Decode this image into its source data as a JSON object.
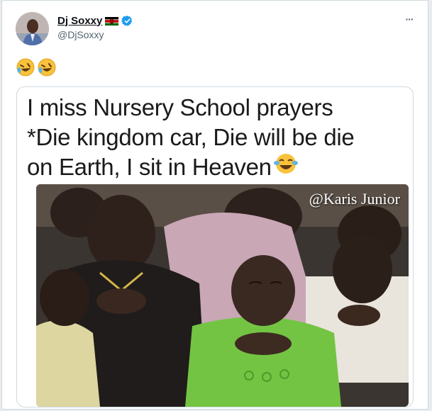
{
  "author": {
    "display_name": "Dj Soxxy",
    "handle": "@DjSoxxy",
    "flag_icon": "kenya-flag-icon",
    "verified_icon": "verified-badge-icon",
    "verified_color": "#1d9bf0"
  },
  "menu": {
    "more_icon": "more-horizontal-icon",
    "glyph": "···"
  },
  "tweet": {
    "emoji": [
      "🤣",
      "🤣"
    ]
  },
  "media": {
    "caption_line1": "I miss Nursery School prayers",
    "caption_line2": "*Die kingdom car, Die  will be die",
    "caption_line3": "on Earth, I sit in Heaven",
    "caption_emoji": "😂",
    "watermark": "@Karis Junior"
  },
  "colors": {
    "text_primary": "#0f1419",
    "text_secondary": "#536471",
    "border": "#cfd9de"
  }
}
